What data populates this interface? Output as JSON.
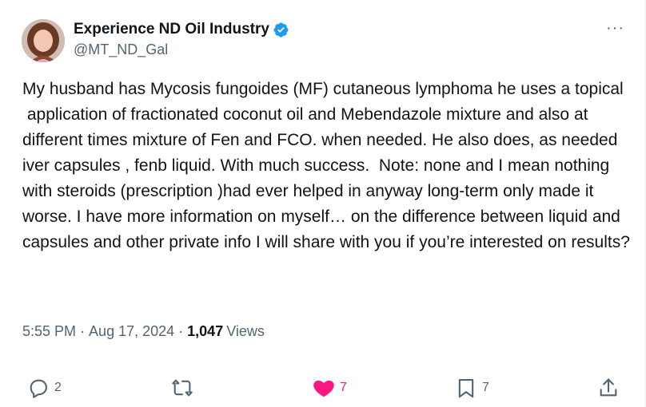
{
  "author": {
    "display_name": "Experience ND Oil Industry",
    "handle": "@MT_ND_Gal",
    "verified": true,
    "verified_color": "#1d9bf0"
  },
  "tweet": {
    "text": "My husband has Mycosis fungoides (MF) cutaneous lymphoma he uses a topical\n application of fractionated coconut oil and Mebendazole mixture and also at different times mixture of Fen and FCO. when needed. He also does, as needed iver capsules , fenb liquid. With much success.  Note: none and I mean nothing with steroids (prescription )had ever helped in anyway long-term only made it worse. I have more information on myself… on the difference between liquid and capsules and other private info I will share with you if you’re interested on results?",
    "time": "5:55 PM",
    "date": "Aug 17, 2024",
    "views_count": "1,047",
    "views_label": "Views"
  },
  "actions": {
    "reply": {
      "icon": "reply-icon",
      "count": "2"
    },
    "retweet": {
      "icon": "retweet-icon",
      "count": ""
    },
    "like": {
      "icon": "heart-icon",
      "count": "7",
      "color": "#f91880"
    },
    "bookmark": {
      "icon": "bookmark-icon",
      "count": "7"
    },
    "share": {
      "icon": "share-icon"
    }
  },
  "more_menu": {
    "icon": "more-options-icon",
    "label": "···"
  }
}
